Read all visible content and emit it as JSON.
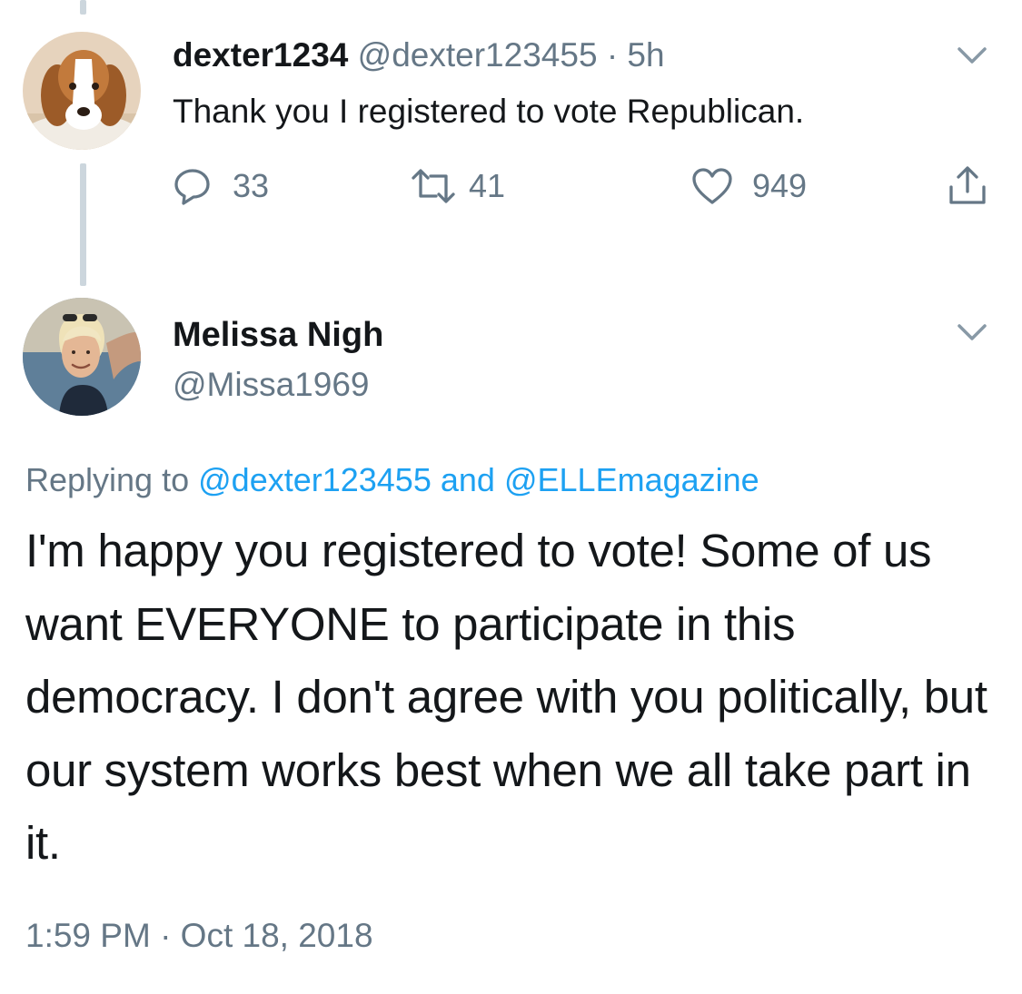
{
  "tweet1": {
    "display_name": "dexter1234",
    "handle": "@dexter123455",
    "separator": "·",
    "time": "5h",
    "text": "Thank you I registered to vote Republican.",
    "avatar_icon": "beagle-dog-avatar",
    "actions": {
      "reply_count": "33",
      "retweet_count": "41",
      "like_count": "949"
    }
  },
  "tweet2": {
    "display_name": "Melissa Nigh",
    "handle": "@Missa1969",
    "avatar_icon": "woman-smiling-avatar",
    "replying_prefix": "Replying to",
    "replying_user1": "@dexter123455",
    "replying_and": "and",
    "replying_user2": "@ELLEmagazine",
    "text": "I'm happy you registered to vote! Some of us want EVERYONE to participate in this democracy. I don't agree with you politically, but our system works best when we all take part in it.",
    "timestamp": "1:59 PM · Oct 18, 2018"
  },
  "colors": {
    "text": "#14171a",
    "muted": "#657786",
    "link": "#1da1f2",
    "thread_line": "#ccd6dd"
  }
}
